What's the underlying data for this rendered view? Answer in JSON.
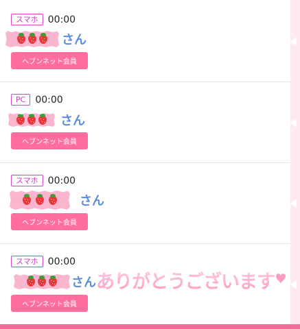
{
  "entries": [
    {
      "device": "スマホ",
      "time": "00:00",
      "suffix": "さん",
      "button": "ヘブンネット会員"
    },
    {
      "device": "PC",
      "time": "00:00",
      "suffix": "さん",
      "button": "ヘブンネット会員"
    },
    {
      "device": "スマホ",
      "time": "00:00",
      "suffix": "さん",
      "button": "ヘブンネット会員"
    },
    {
      "device": "スマホ",
      "time": "00:00",
      "suffix": "さん",
      "button": "ヘブンネット会員"
    }
  ],
  "stamp": {
    "text": "ありがとうございます"
  },
  "colors": {
    "device_border": "#d246c8",
    "name_blue": "#5b8ce0",
    "button_pink": "#ff6e9e",
    "tape_pink": "#fbb6cf",
    "sidebar_pink": "#ffe9ee",
    "bottom_bar": "#f06e9b"
  },
  "icons": [
    "strawberry-icon",
    "heart-icon",
    "arrow-left-icon"
  ]
}
